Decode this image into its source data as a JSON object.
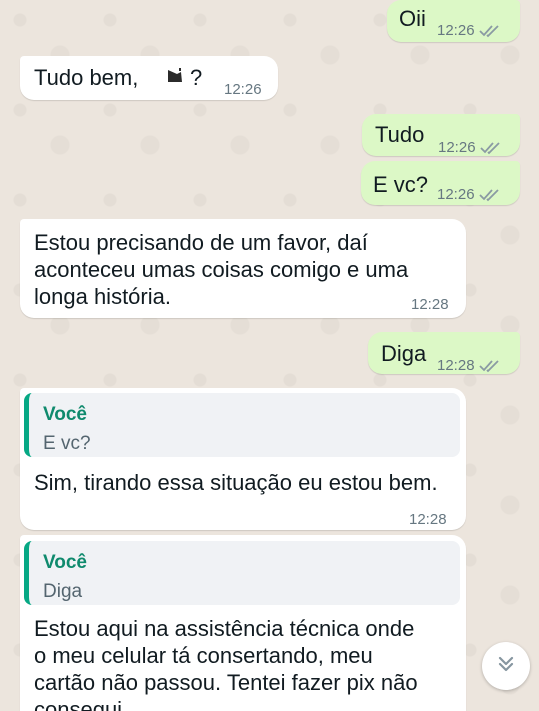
{
  "messages": {
    "m1": {
      "text": "Oii",
      "time": "12:26"
    },
    "m2": {
      "text_before": "Tudo bem,",
      "text_after": "?",
      "time": "12:26"
    },
    "m3": {
      "text": "Tudo",
      "time": "12:26"
    },
    "m4": {
      "text": "E vc?",
      "time": "12:26"
    },
    "m5": {
      "line1": "Estou precisando de um favor, daí",
      "line2": "aconteceu umas coisas comigo e uma",
      "line3": "longa história.",
      "time": "12:28"
    },
    "m6": {
      "text": "Diga",
      "time": "12:28"
    },
    "m7": {
      "quote_author": "Você",
      "quote_text": "E vc?",
      "text": "Sim, tirando essa situação eu estou bem.",
      "time": "12:28"
    },
    "m8": {
      "quote_author": "Você",
      "quote_text": "Diga",
      "line1": "Estou aqui na assistência técnica onde",
      "line2": "o meu celular tá consertando, meu",
      "line3": "cartão não passou. Tentei fazer pix não",
      "line4": "consegui"
    }
  },
  "colors": {
    "outgoing": "#dcf8c6",
    "incoming": "#ffffff",
    "accent": "#06a884",
    "read_ticks": "#8a9aa3"
  },
  "icons": {
    "ticks": "double-check-icon",
    "scroll": "chevron-double-down-icon",
    "inline": "bulb-emoji-icon"
  }
}
